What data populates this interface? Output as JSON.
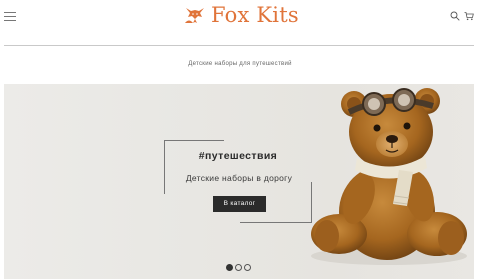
{
  "header": {
    "logo_text": "Fox Kits",
    "icons": [
      "menu-icon",
      "fox-logo-icon",
      "search-icon",
      "cart-icon"
    ]
  },
  "tagline": "Детские наборы для путешествий",
  "banner": {
    "title": "#путешествия",
    "subtitle": "Детские наборы в дорогу",
    "button_label": "В каталог",
    "slides": 3,
    "active_slide": 1
  },
  "colors": {
    "brand": "#e0743a",
    "button_bg": "#2b2b2b",
    "banner_bg": "#e8e7e3"
  }
}
